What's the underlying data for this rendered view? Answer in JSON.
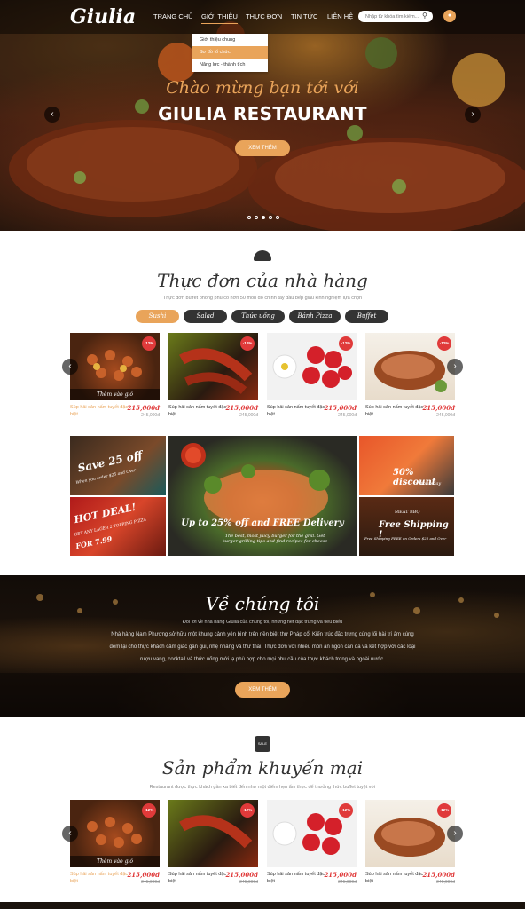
{
  "nav": {
    "logo": "Giulia",
    "items": [
      "TRANG CHỦ",
      "GIỚI THIỆU",
      "THỰC ĐƠN",
      "TIN TỨC",
      "LIÊN HỆ"
    ],
    "search_placeholder": "Nhập từ khóa tìm kiếm...",
    "dropdown": [
      "Giới thiệu chung",
      "Sơ đồ tổ chức",
      "Năng lực - thành tích"
    ]
  },
  "hero": {
    "script": "Chào mừng bạn tới với",
    "title": "GIULIA RESTAURANT",
    "button": "XEM THÊM"
  },
  "menu_section": {
    "title": "Thực đơn của nhà hàng",
    "subtitle": "Thực đơn buffet phong phú có hơn 50 món do chính tay đầu bếp giàu kinh nghiệm lựa chọn",
    "tabs": [
      "Sushi",
      "Salad",
      "Thức uống",
      "Bánh Pizza",
      "Buffet"
    ]
  },
  "products": [
    {
      "name": "Súp hải sản nấm tuyết đặc biệt",
      "price": "215,000đ",
      "old": "245,000đ",
      "badge": "-12%",
      "add": "Thêm vào giỏ"
    },
    {
      "name": "Súp hải sản nấm tuyết đặc biệt",
      "price": "215,000đ",
      "old": "245,000đ",
      "badge": "-12%"
    },
    {
      "name": "Súp hải sản nấm tuyết đặc biệt",
      "price": "215,000đ",
      "old": "245,000đ",
      "badge": "-12%"
    },
    {
      "name": "Súp hải sản nấm tuyết đặc biệt",
      "price": "215,000đ",
      "old": "245,000đ",
      "badge": "-12%"
    }
  ],
  "banners": {
    "b1": "Save 25 off",
    "b1_sub": "When you order $25 and Over",
    "b2": "HOT DEAL!",
    "b2_sub": "GET ANY LAGER 2 TOPPING PIZZA",
    "b2_price": "FOR 7.99",
    "center": "Up to 25% off and FREE Delivery",
    "center_sub": "The best, most juicy burger for the grill. Get burger grilling tips and find recipes for cheese",
    "r1": "50% discount",
    "r1_sub": "on thursday",
    "r2_tag": "MEAT BBQ",
    "r2": "Free Shipping !",
    "r2_sub": "Free Shipping FREE on Orders $25 and Over"
  },
  "about": {
    "title": "Về chúng tôi",
    "lead": "Đôi lời về nhà hàng Giulia của chúng tôi, những nét đặc trưng và tiêu biểu",
    "line1": "Nhà hàng Nam Phương sở hữu một khung cảnh yên bình trên nền biệt thự Pháp cổ. Kiến trúc đặc trưng cùng lối bài trí ấm cúng",
    "line2": "đem lại cho thực khách cảm giác gần gũi, nhẹ nhàng và thư thái. Thực đơn với nhiều món ăn ngon cân đã và kết hợp với các loại",
    "line3": "rượu vang, cocktail và thức uống mới lạ phù hợp cho mọi nhu cầu của thực khách trong và ngoài nước.",
    "button": "XEM THÊM"
  },
  "promo": {
    "title": "Sản phẩm khuyến mại",
    "subtitle": "Restaurant được thực khách gần xa biết đến như một điểm hẹn ẩm thực để thưởng thức buffet tuyệt vời",
    "icon_label": "SALE"
  }
}
